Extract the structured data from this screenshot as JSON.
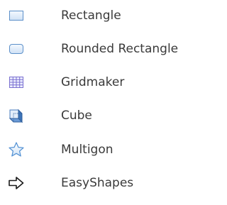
{
  "menu": {
    "items": [
      {
        "label": "Rectangle",
        "icon": "rectangle-icon"
      },
      {
        "label": "Rounded Rectangle",
        "icon": "rounded-rectangle-icon"
      },
      {
        "label": "Gridmaker",
        "icon": "grid-icon"
      },
      {
        "label": "Cube",
        "icon": "cube-icon"
      },
      {
        "label": "Multigon",
        "icon": "star-icon"
      },
      {
        "label": "EasyShapes",
        "icon": "arrow-right-icon"
      }
    ]
  },
  "colors": {
    "text": "#3a3a3a",
    "icon_stroke": "#5b8fc9",
    "icon_fill": "#dbe9f7",
    "grid_stroke": "#7a6fd0"
  }
}
